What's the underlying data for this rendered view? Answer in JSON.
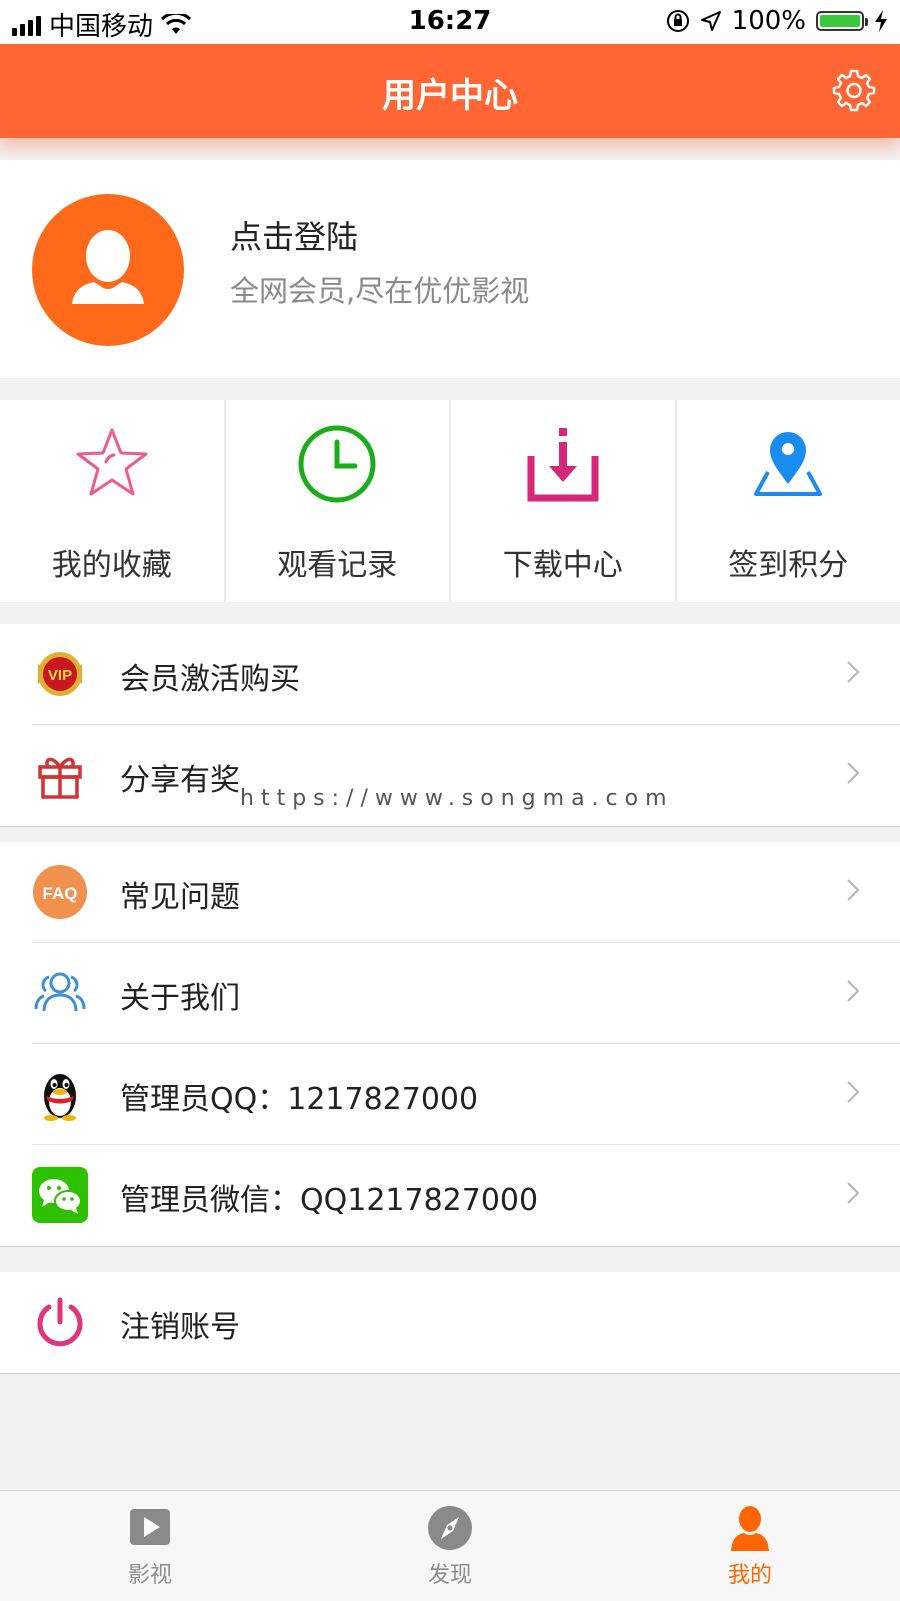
{
  "status_bar": {
    "carrier": "中国移动",
    "time": "16:27",
    "battery": "100%",
    "battery_level": 1.0
  },
  "header": {
    "title": "用户中心",
    "settings_icon": "gear-icon"
  },
  "profile": {
    "name": "点击登陆",
    "subtitle": "全网会员,尽在优优影视",
    "avatar_color": "#ff6a1a"
  },
  "shortcuts": [
    {
      "label": "我的收藏",
      "icon": "star-icon",
      "color": "#ee5b8f"
    },
    {
      "label": "观看记录",
      "icon": "clock-icon",
      "color": "#1aad19"
    },
    {
      "label": "下载中心",
      "icon": "download-icon",
      "color": "#d6287a"
    },
    {
      "label": "签到积分",
      "icon": "map-pin-icon",
      "color": "#1a8cf0"
    }
  ],
  "menu_group_1": [
    {
      "label": "会员激活购买",
      "icon": "vip-badge-icon"
    },
    {
      "label": "分享有奖",
      "icon": "gift-icon"
    }
  ],
  "watermark": "https://www.songma.com",
  "menu_group_2": [
    {
      "label": "常见问题",
      "icon": "faq-icon",
      "badge_text": "FAQ"
    },
    {
      "label": "关于我们",
      "icon": "users-icon"
    },
    {
      "label": "管理员QQ：1217827000",
      "icon": "qq-penguin-icon"
    },
    {
      "label": "管理员微信：QQ1217827000",
      "icon": "wechat-icon"
    }
  ],
  "menu_group_3": [
    {
      "label": "注销账号",
      "icon": "power-icon"
    }
  ],
  "tab_bar": [
    {
      "label": "影视",
      "icon": "play-icon",
      "active": false
    },
    {
      "label": "发现",
      "icon": "compass-icon",
      "active": false
    },
    {
      "label": "我的",
      "icon": "user-icon",
      "active": true
    }
  ],
  "colors": {
    "brand": "#ff6633",
    "active_tab": "#ff6600"
  }
}
